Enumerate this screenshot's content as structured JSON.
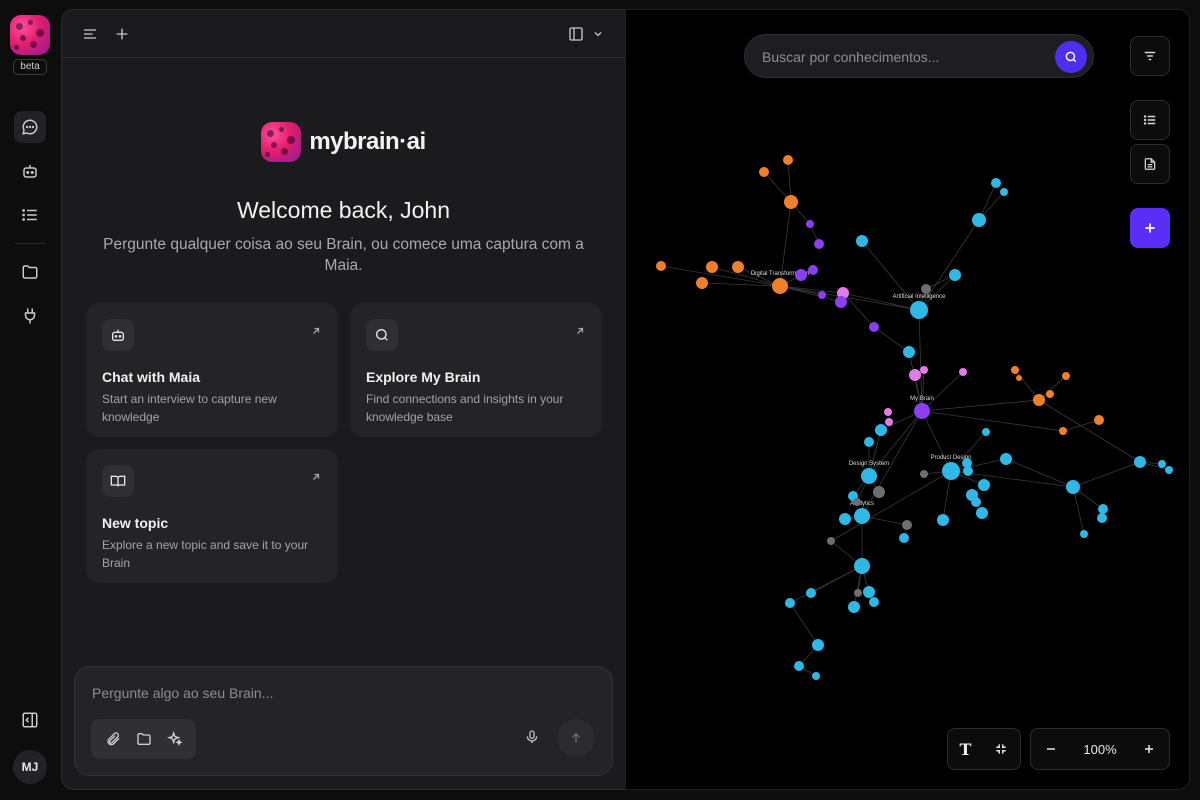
{
  "rail": {
    "beta_label": "beta",
    "items": [
      {
        "name": "chat",
        "icon": "chat-bubble-icon",
        "active": true
      },
      {
        "name": "bot",
        "icon": "bot-icon",
        "active": false
      },
      {
        "name": "list",
        "icon": "list-icon",
        "active": false
      },
      {
        "name": "folder",
        "icon": "folder-icon",
        "active": false
      },
      {
        "name": "plugin",
        "icon": "plug-icon",
        "active": false
      }
    ],
    "avatar_initials": "MJ"
  },
  "brand": {
    "name": "mybrain·ai"
  },
  "welcome": {
    "title": "Welcome back, John",
    "subtitle": "Pergunte qualquer coisa ao seu Brain, ou comece uma captura com a Maia."
  },
  "cards": [
    {
      "title": "Chat with Maia",
      "desc": "Start an interview to capture new knowledge",
      "icon": "bot-icon"
    },
    {
      "title": "Explore My Brain",
      "desc": "Find connections and insights in your knowledge base",
      "icon": "search-icon"
    },
    {
      "title": "New topic",
      "desc": "Explore a new topic and save it to your Brain",
      "icon": "book-icon"
    }
  ],
  "composer": {
    "placeholder": "Pergunte algo ao seu Brain..."
  },
  "graph": {
    "search_placeholder": "Buscar por conhecimentos...",
    "zoom": "100%",
    "colors": {
      "blue": "#2fb8e6",
      "orange": "#f07f2c",
      "purple": "#8b3ff0",
      "pink": "#e27be8",
      "gray": "#6e6e72",
      "accent": "#5a2ef5"
    },
    "labels": {
      "ai": "Artificial Intelligence",
      "design": "Product Design",
      "systems": "Design System",
      "mybrain": "My Brain",
      "digital": "Digital Transformation",
      "analytics": "Analytics"
    }
  }
}
